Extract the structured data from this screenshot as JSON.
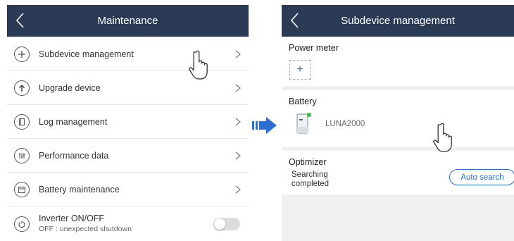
{
  "left": {
    "title": "Maintenance",
    "items": [
      {
        "label": "Subdevice management",
        "icon": "plus-icon"
      },
      {
        "label": "Upgrade device",
        "icon": "upgrade-arrow-icon"
      },
      {
        "label": "Log management",
        "icon": "log-icon"
      },
      {
        "label": "Performance data",
        "icon": "performance-icon"
      },
      {
        "label": "Battery maintenance",
        "icon": "battery-calendar-icon"
      }
    ],
    "inverter": {
      "label": "Inverter ON/OFF",
      "status": "OFF : unexpected shutdown",
      "toggle_on": false,
      "icon": "power-icon"
    }
  },
  "right": {
    "title": "Subdevice management",
    "power_meter": {
      "title": "Power meter",
      "add_label": "+"
    },
    "battery": {
      "title": "Battery",
      "device_name": "LUNA2000",
      "status_color": "#3cc24a"
    },
    "optimizer": {
      "title": "Optimizer",
      "status_line1": "Searching",
      "status_line2": "completed",
      "button_label": "Auto search"
    }
  },
  "colors": {
    "header_bg": "#2b3b55",
    "accent": "#2a6fd1",
    "arrow": "#2a6fd1"
  }
}
